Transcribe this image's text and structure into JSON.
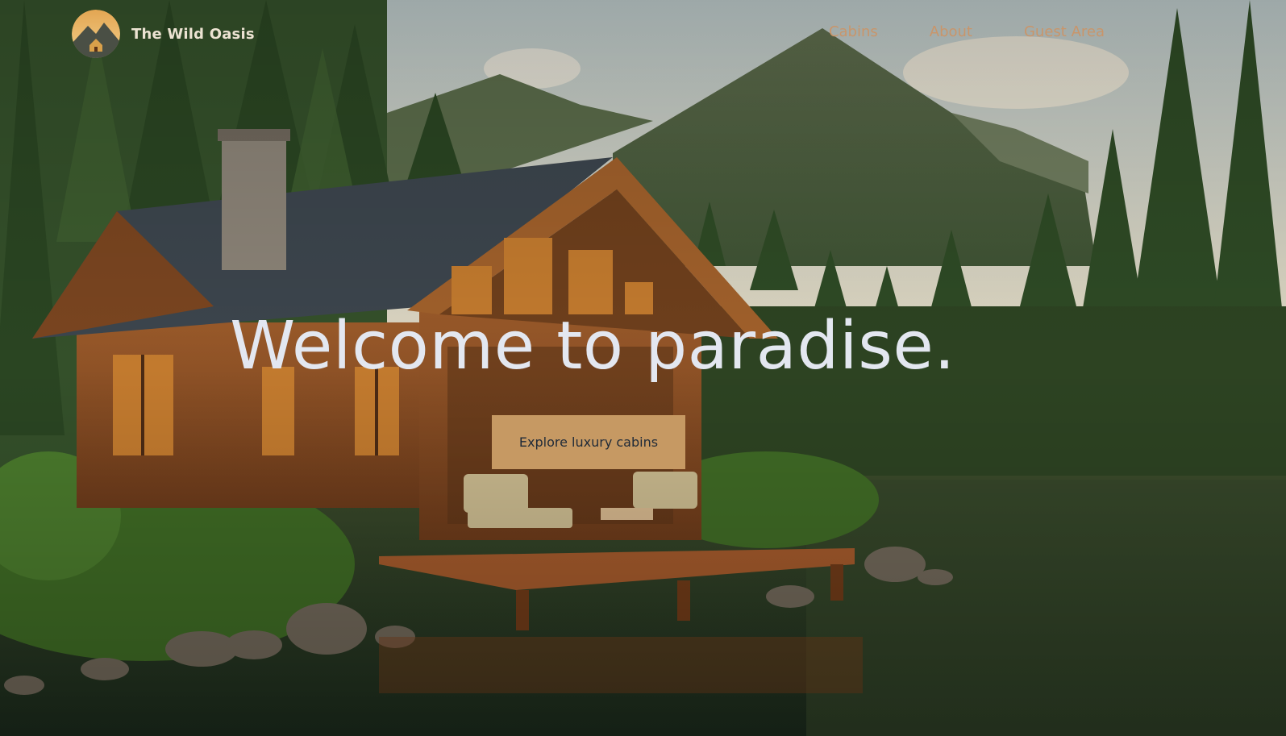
{
  "brand": {
    "name": "The Wild Oasis",
    "logo_icon": "cabin-mountain-logo-icon"
  },
  "nav": {
    "items": [
      {
        "label": "Cabins"
      },
      {
        "label": "About"
      },
      {
        "label": "Guest Area"
      }
    ]
  },
  "hero": {
    "title": "Welcome to paradise.",
    "cta_label": "Explore luxury cabins",
    "background": "cabin-by-lake-forest-mountains-image"
  },
  "colors": {
    "accent": "#c69963",
    "nav_text": "#c9956a",
    "title_text": "#e3e7f0",
    "button_text": "#1f2a38"
  }
}
